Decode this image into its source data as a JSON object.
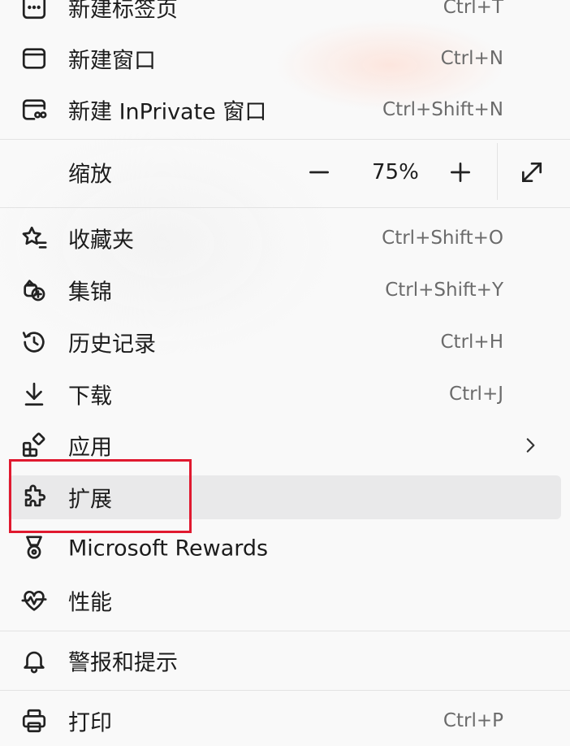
{
  "menu": {
    "new_tab": {
      "label": "新建标签页",
      "shortcut": "Ctrl+T"
    },
    "new_window": {
      "label": "新建窗口",
      "shortcut": "Ctrl+N"
    },
    "new_inprivate": {
      "label": "新建 InPrivate 窗口",
      "shortcut": "Ctrl+Shift+N"
    },
    "zoom": {
      "label": "缩放",
      "value": "75%"
    },
    "favorites": {
      "label": "收藏夹",
      "shortcut": "Ctrl+Shift+O"
    },
    "collections": {
      "label": "集锦",
      "shortcut": "Ctrl+Shift+Y"
    },
    "history": {
      "label": "历史记录",
      "shortcut": "Ctrl+H"
    },
    "downloads": {
      "label": "下载",
      "shortcut": "Ctrl+J"
    },
    "apps": {
      "label": "应用"
    },
    "extensions": {
      "label": "扩展"
    },
    "rewards": {
      "label": "Microsoft Rewards"
    },
    "performance": {
      "label": "性能"
    },
    "alerts": {
      "label": "警报和提示"
    },
    "print": {
      "label": "打印",
      "shortcut": "Ctrl+P"
    }
  },
  "colors": {
    "highlight_box": "#e0192f",
    "hover_bg": "#e9e9ea"
  }
}
